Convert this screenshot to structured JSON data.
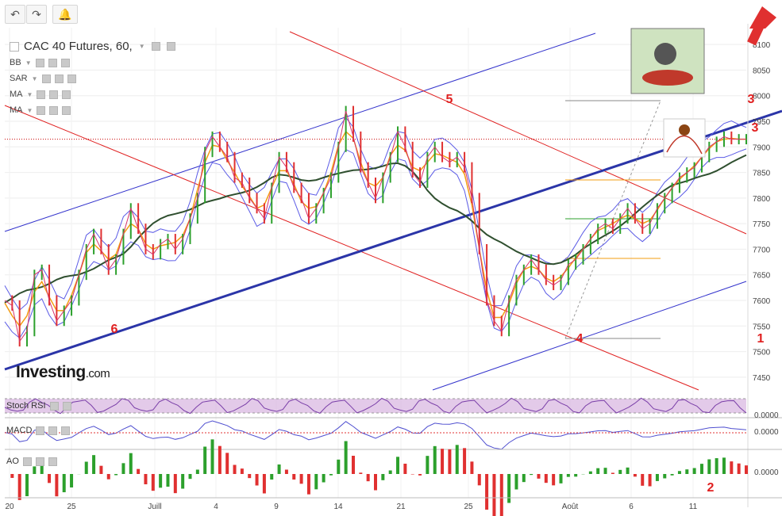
{
  "toolbar": {
    "undo_icon": "undo-icon",
    "redo_icon": "redo-icon",
    "alert_icon": "bell-plus-icon"
  },
  "title": "CAC 40 Futures, 60,",
  "indicators": [
    "BB",
    "SAR",
    "MA",
    "MA"
  ],
  "pane_labels": {
    "stoch": "Stoch RSI",
    "macd": "MACD",
    "ao": "AO"
  },
  "logo": {
    "main": "Investing",
    "suffix": ".com"
  },
  "colors": {
    "price_up": "#2ca02c",
    "price_down": "#e03030",
    "bb": "#5b5be6",
    "ma_long": "#2f4f2f",
    "ma_fast": "#f39c12",
    "trend_blue": "#2b35a8",
    "channel_red": "#e02020",
    "stoch_band": "#d7b4e0"
  },
  "chart_data": {
    "type": "line",
    "title": "CAC 40 Futures, 60,",
    "x_ticks": [
      "20",
      "25",
      "Juill",
      "4",
      "9",
      "14",
      "21",
      "25",
      "Août",
      "6",
      "11"
    ],
    "y_ticks": [
      8100,
      8050,
      8000,
      7950,
      7900,
      7850,
      7800,
      7750,
      7700,
      7650,
      7600,
      7550,
      7500,
      7450
    ],
    "ylim": [
      7425,
      8125
    ],
    "last_price_level": 7915,
    "series": [
      {
        "x": [
          0,
          1,
          2,
          3,
          4,
          5,
          6,
          7,
          8,
          9,
          10,
          11,
          12,
          13,
          14,
          15,
          16,
          17,
          18,
          19,
          20,
          21,
          22,
          23,
          24,
          25,
          26,
          27,
          28,
          29,
          30,
          31,
          32,
          33,
          34,
          35,
          36,
          37,
          38,
          39,
          40,
          41,
          42,
          43,
          44,
          45,
          46,
          47,
          48,
          49,
          50,
          51,
          52,
          53,
          54,
          55,
          56,
          57,
          58,
          59,
          60,
          61,
          62,
          63,
          64,
          65,
          66,
          67,
          68,
          69,
          70,
          71,
          72,
          73,
          74,
          75,
          76,
          77,
          78,
          79,
          80,
          81,
          82,
          83,
          84,
          85,
          86,
          87,
          88,
          89,
          90,
          91,
          92,
          93,
          94,
          95,
          96,
          97,
          98,
          99,
          100
        ],
        "values": [
          7600,
          7590,
          7520,
          7540,
          7650,
          7660,
          7600,
          7560,
          7580,
          7600,
          7650,
          7700,
          7730,
          7700,
          7660,
          7680,
          7730,
          7780,
          7740,
          7700,
          7690,
          7710,
          7720,
          7700,
          7720,
          7760,
          7800,
          7890,
          7920,
          7900,
          7880,
          7840,
          7830,
          7800,
          7780,
          7760,
          7820,
          7880,
          7860,
          7820,
          7800,
          7760,
          7780,
          7810,
          7840,
          7900,
          7970,
          7920,
          7860,
          7830,
          7800,
          7840,
          7880,
          7930,
          7900,
          7850,
          7830,
          7880,
          7900,
          7880,
          7870,
          7880,
          7860,
          7800,
          7700,
          7600,
          7560,
          7540,
          7600,
          7640,
          7660,
          7680,
          7660,
          7640,
          7630,
          7640,
          7670,
          7680,
          7700,
          7720,
          7740,
          7750,
          7740,
          7760,
          7780,
          7760,
          7740,
          7750,
          7780,
          7800,
          7820,
          7840,
          7850,
          7860,
          7880,
          7900,
          7910,
          7920,
          7915,
          7915,
          7915
        ]
      }
    ],
    "annotations": [
      "1",
      "2",
      "3",
      "3",
      "4",
      "5",
      "6"
    ],
    "subpanels": [
      {
        "name": "Stoch RSI",
        "value_label": "0.0000"
      },
      {
        "name": "MACD",
        "value_label": "0.0000"
      },
      {
        "name": "AO",
        "value_label": "0.0000"
      }
    ]
  }
}
